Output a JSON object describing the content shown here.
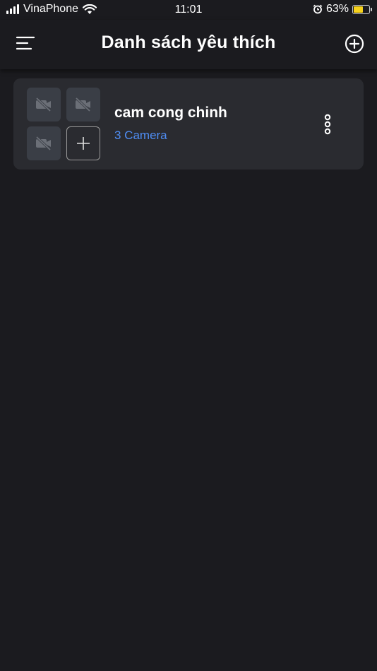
{
  "status_bar": {
    "carrier": "VinaPhone",
    "time": "11:01",
    "battery_percent": "63%",
    "battery_level": 0.63,
    "icons": [
      "signal-icon",
      "wifi-icon",
      "alarm-icon",
      "battery-icon"
    ]
  },
  "header": {
    "title": "Danh sách yêu thích",
    "menu_icon": "menu-icon",
    "add_icon": "add-circle-icon"
  },
  "favorite_groups": [
    {
      "name": "cam cong chinh",
      "camera_count_label": "3 Camera",
      "thumbnail_icons": [
        "video-off-icon",
        "video-off-icon",
        "video-off-icon"
      ],
      "add_thumbnail_icon": "plus-icon",
      "menu_icon": "more-vertical-icon"
    }
  ],
  "colors": {
    "background": "#1b1b1f",
    "card": "#2a2b30",
    "thumbnail": "#3a3e46",
    "accent": "#4f8ef5",
    "battery": "#f7d21c"
  }
}
